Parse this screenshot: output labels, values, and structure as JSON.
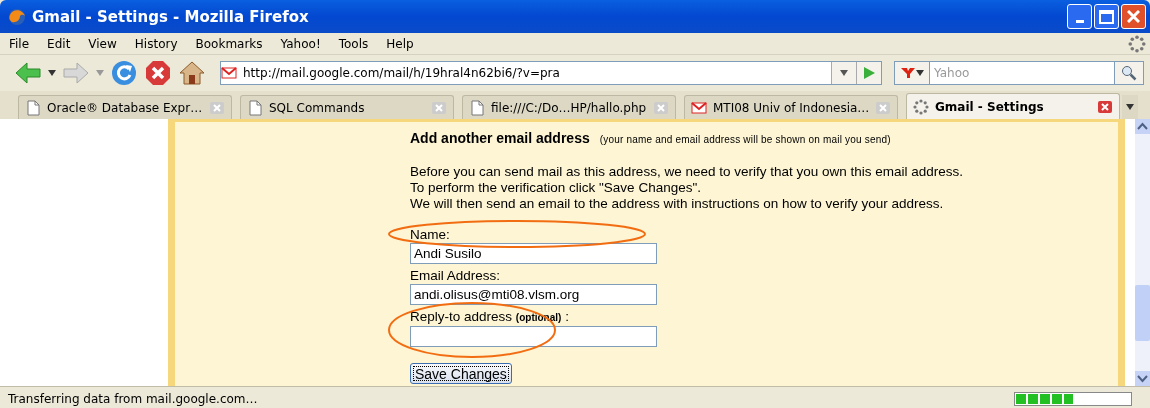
{
  "window": {
    "title": "Gmail - Settings - Mozilla Firefox"
  },
  "menu": [
    "File",
    "Edit",
    "View",
    "History",
    "Bookmarks",
    "Yahoo!",
    "Tools",
    "Help"
  ],
  "toolbar": {
    "url": "http://mail.google.com/mail/h/19hral4n62bi6/?v=pra",
    "search_placeholder": "Yahoo"
  },
  "tabs": [
    {
      "label": "Oracle® Database Expr…",
      "kind": "page",
      "selected": false
    },
    {
      "label": "SQL Commands",
      "kind": "page",
      "selected": false
    },
    {
      "label": "file:///C:/Do…HP/hallo.php",
      "kind": "page",
      "selected": false
    },
    {
      "label": "MTI08 Univ of Indonesia…",
      "kind": "mail",
      "selected": false
    },
    {
      "label": "Gmail - Settings",
      "kind": "loading",
      "selected": true
    }
  ],
  "form": {
    "heading": "Add another email address",
    "heading_note": "(your name and email address will be shown on mail you send)",
    "paragraph": [
      "Before you can send mail as this address, we need to verify that you own this email address.",
      "To perform the verification click \"Save Changes\".",
      "We will then send an email to the address with instructions on how to verify your address."
    ],
    "fields": [
      {
        "label": "Name:",
        "value": "Andi Susilo"
      },
      {
        "label": "Email Address:",
        "value": "andi.olisus@mti08.vlsm.org"
      },
      {
        "label": "Reply-to address",
        "note": "(optional)",
        "suffix": " :"
      }
    ],
    "button": "Save Changes"
  },
  "annotations": [
    {
      "kind": "ellipse"
    },
    {
      "kind": "ellipse"
    }
  ],
  "status_bar": {
    "text": "Transferring data from mail.google.com…",
    "progress": {
      "level": 0.5
    }
  }
}
